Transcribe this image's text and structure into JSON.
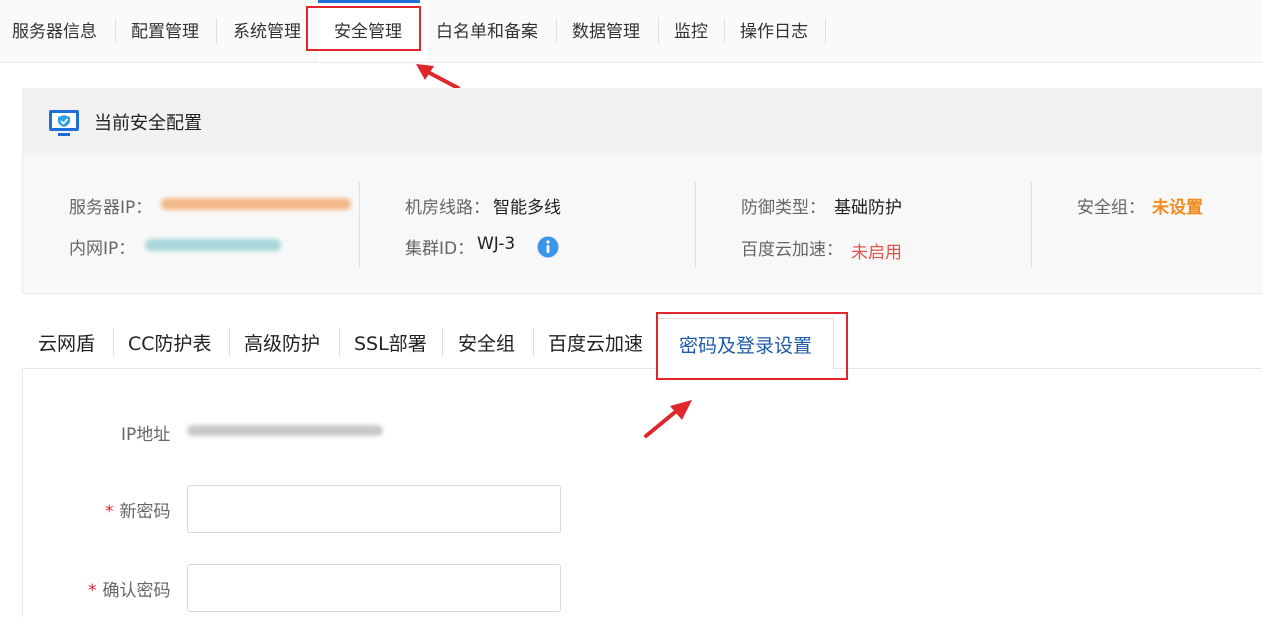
{
  "topnav": {
    "tabs": [
      {
        "label": "服务器信息"
      },
      {
        "label": "配置管理"
      },
      {
        "label": "系统管理"
      },
      {
        "label": "安全管理"
      },
      {
        "label": "白名单和备案"
      },
      {
        "label": "数据管理"
      },
      {
        "label": "监控"
      },
      {
        "label": "操作日志"
      }
    ],
    "active_index": 3
  },
  "section": {
    "title": "当前安全配置",
    "icon": "monitor-shield-icon"
  },
  "info": {
    "server_ip_label": "服务器IP：",
    "intranet_ip_label": "内网IP：",
    "line_label": "机房线路：",
    "line_value": "智能多线",
    "cluster_label": "集群ID：",
    "cluster_value": "WJ-3",
    "defense_label": "防御类型：",
    "defense_value": "基础防护",
    "baidu_label": "百度云加速：",
    "baidu_value": "未启用",
    "secgroup_label": "安全组：",
    "secgroup_value": "未设置"
  },
  "subtabs": {
    "tabs": [
      {
        "label": "云网盾"
      },
      {
        "label": "CC防护表"
      },
      {
        "label": "高级防护"
      },
      {
        "label": "SSL部署"
      },
      {
        "label": "安全组"
      },
      {
        "label": "百度云加速"
      },
      {
        "label": "密码及登录设置"
      }
    ],
    "active_index": 6
  },
  "form": {
    "ip_label": "IP地址",
    "required_mark": "*",
    "new_password_label": "新密码",
    "confirm_password_label": "确认密码"
  },
  "colors": {
    "accent": "#1e6fd9",
    "highlight": "#e0252b",
    "warning": "#f08c1e",
    "danger": "#e2534c"
  }
}
